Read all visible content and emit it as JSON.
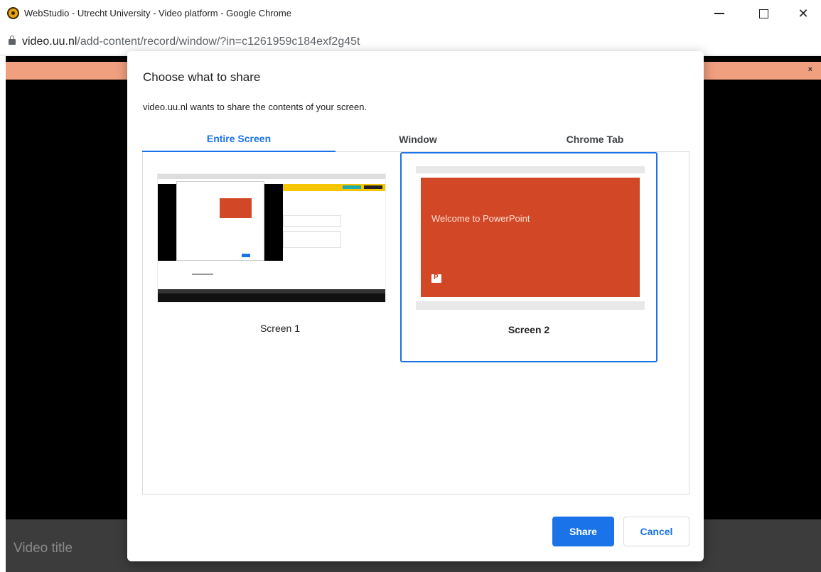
{
  "window": {
    "title": "WebStudio - Utrecht University - Video platform - Google Chrome",
    "url_host": "video.uu.nl",
    "url_path": "/add-content/record/window/?in=c1261959c184exf2g45t"
  },
  "page": {
    "banner_close": "×",
    "video_title_placeholder": "Video title"
  },
  "dialog": {
    "title": "Choose what to share",
    "subtitle": "video.uu.nl wants to share the contents of your screen.",
    "tabs": [
      {
        "label": "Entire Screen",
        "selected": true
      },
      {
        "label": "Window",
        "selected": false
      },
      {
        "label": "Chrome Tab",
        "selected": false
      }
    ],
    "screens": [
      {
        "label": "Screen 1",
        "selected": false
      },
      {
        "label": "Screen 2",
        "selected": true,
        "thumbnail_text": "Welcome to PowerPoint"
      }
    ],
    "share_label": "Share",
    "cancel_label": "Cancel"
  },
  "colors": {
    "accent": "#1a73e8",
    "banner": "#f0a07e",
    "powerpoint": "#d24726"
  }
}
